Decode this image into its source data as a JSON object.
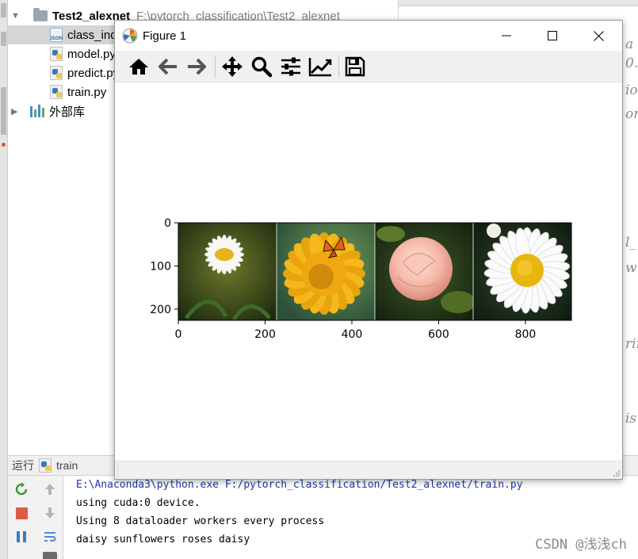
{
  "project_tree": {
    "root_name": "Test2_alexnet",
    "root_path": "F:\\pytorch_classification\\Test2_alexnet",
    "files": [
      {
        "label": "class_indices.json",
        "type": "json"
      },
      {
        "label": "model.py",
        "type": "python"
      },
      {
        "label": "predict.py",
        "type": "python"
      },
      {
        "label": "train.py",
        "type": "python"
      }
    ],
    "external_libs": "外部库"
  },
  "editor_fragments": [
    "a",
    "0.",
    "ion",
    "or",
    "l_",
    "w",
    "rin",
    "is"
  ],
  "run_panel": {
    "label": "运行",
    "config": "train"
  },
  "console": {
    "lines": [
      "E:\\Anaconda3\\python.exe F:/pytorch_classification/Test2_alexnet/train.py",
      "using cuda:0 device.",
      "Using 8 dataloader workers every process",
      "daisy sunflowers roses daisy"
    ]
  },
  "watermark": "CSDN @浅浅ch",
  "figure": {
    "title": "Figure 1",
    "toolbar": [
      {
        "name": "home",
        "icon": "home-icon"
      },
      {
        "name": "back",
        "icon": "arrow-left-icon"
      },
      {
        "name": "forward",
        "icon": "arrow-right-icon"
      },
      {
        "name": "pan",
        "icon": "move-icon"
      },
      {
        "name": "zoom",
        "icon": "magnifier-icon"
      },
      {
        "name": "subplots",
        "icon": "sliders-icon"
      },
      {
        "name": "edit-axis",
        "icon": "line-chart-icon"
      },
      {
        "name": "save",
        "icon": "floppy-icon"
      }
    ]
  },
  "chart_data": {
    "type": "image",
    "xlim": [
      0,
      906
    ],
    "ylim": [
      226,
      0
    ],
    "x_ticks": [
      0,
      200,
      400,
      600,
      800
    ],
    "y_ticks": [
      0,
      100,
      200
    ],
    "panels": [
      "daisy",
      "sunflowers",
      "roses",
      "daisy"
    ]
  },
  "colors": {
    "console_cmd": "#1f3aa6",
    "selection": "#d5d5d5"
  }
}
